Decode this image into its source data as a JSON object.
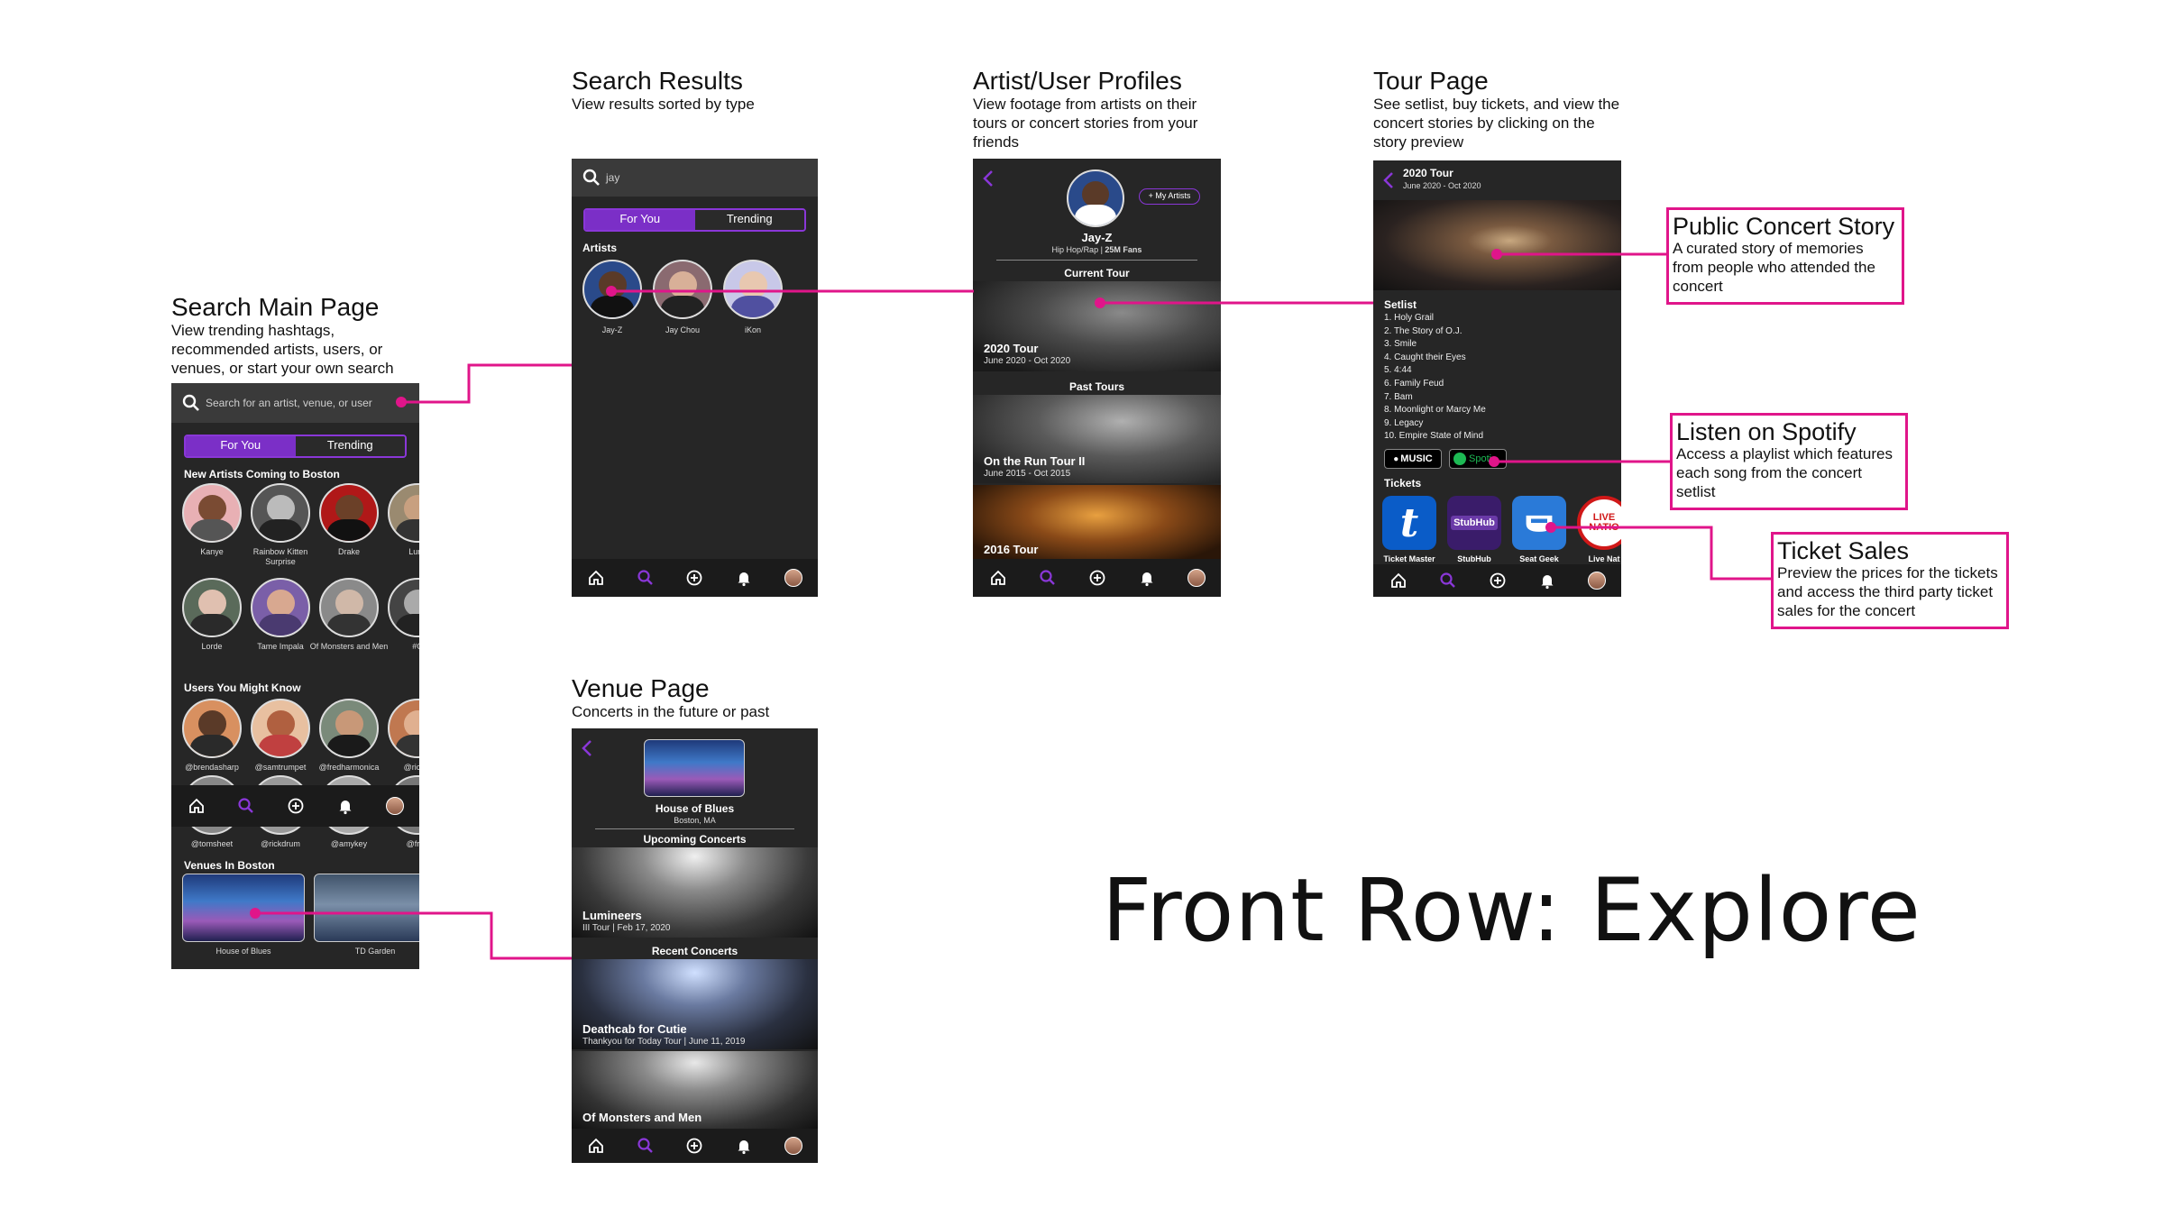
{
  "colors": {
    "accent": "#8a37d8",
    "connector": "#e0158a",
    "phone_bg": "#262626",
    "toggle_on": "#7b2fc7"
  },
  "main_title": "Front Row: Explore",
  "sections": {
    "search_main": {
      "title": "Search Main Page",
      "desc": [
        "View trending hashtags,",
        "recommended artists, users, or",
        "venues, or start your own search"
      ]
    },
    "search_results": {
      "title": "Search Results",
      "desc": [
        "View results sorted by type"
      ]
    },
    "artist_profiles": {
      "title": "Artist/User Profiles",
      "desc": [
        "View footage from artists on their",
        "tours or concert stories from your",
        "friends"
      ]
    },
    "tour_page": {
      "title": "Tour Page",
      "desc": [
        "See setlist, buy tickets, and view the",
        "concert stories by clicking on the",
        "story preview"
      ]
    },
    "venue_page": {
      "title": "Venue Page",
      "desc": [
        "Concerts in the future or past"
      ]
    }
  },
  "callouts": {
    "public_story": {
      "title": "Public Concert Story",
      "desc": [
        "A curated story of memories",
        "from people who attended the",
        "concert"
      ]
    },
    "spotify": {
      "title": "Listen on Spotify",
      "desc": [
        "Access a playlist which features",
        "each song from the concert",
        "setlist"
      ]
    },
    "tickets": {
      "title": "Ticket Sales",
      "desc": [
        "Preview the prices for the tickets",
        "and access the third party ticket",
        "sales for the concert"
      ]
    }
  },
  "search_main_phone": {
    "search_placeholder": "Search for an artist, venue, or user",
    "tabs": [
      "For You",
      "Trending"
    ],
    "new_artists_label": "New Artists Coming to Boston",
    "artists_row1": [
      "Kanye",
      "Rainbow Kitten Surprise",
      "Drake",
      "Lumi"
    ],
    "artists_row2": [
      "Lorde",
      "Tame Impala",
      "Of Monsters and Men",
      "#C"
    ],
    "users_label": "Users You Might Know",
    "users_row1": [
      "@brendasharp",
      "@samtrumpet",
      "@fredharmonica",
      "@rickm"
    ],
    "users_row2": [
      "@tomsheet",
      "@rickdrum",
      "@amykey",
      "@fred"
    ],
    "venues_label": "Venues In Boston",
    "venues": [
      "House of Blues",
      "TD Garden"
    ]
  },
  "search_results_phone": {
    "query": "jay",
    "tabs": [
      "For You",
      "Trending"
    ],
    "artists_label": "Artists",
    "artists": [
      "Jay-Z",
      "Jay Chou",
      "iKon"
    ]
  },
  "artist_phone": {
    "my_artists_btn": "+ My Artists",
    "name": "Jay-Z",
    "genre": "Hip Hop/Rap | ",
    "fans": "25M Fans",
    "current_tour_label": "Current Tour",
    "current_tour": {
      "title": "2020 Tour",
      "dates": "June 2020 - Oct 2020"
    },
    "past_tours_label": "Past Tours",
    "past_tours": [
      {
        "title": "On the Run Tour II",
        "dates": "June 2015 - Oct 2015"
      },
      {
        "title": "2016 Tour",
        "dates": ""
      }
    ]
  },
  "tour_phone": {
    "title": "2020 Tour",
    "dates": "June 2020 - Oct 2020",
    "setlist_label": "Setlist",
    "setlist": [
      "1. Holy Grail",
      "2. The Story of O.J.",
      "3. Smile",
      "4. Caught their Eyes",
      "5. 4:44",
      "6. Family Feud",
      "7. Bam",
      "8. Moonlight or Marcy Me",
      "9. Legacy",
      "10. Empire State of Mind"
    ],
    "apple_music": "MUSIC",
    "spotify": "Spoti",
    "tickets_label": "Tickets",
    "ticket_sellers": [
      "Ticket Master",
      "StubHub",
      "Seat Geek",
      "Live Nat"
    ],
    "stubhub_logo": "StubHub",
    "ticketmaster_logo": "t",
    "livenation_logo": "LIVE NATIO"
  },
  "venue_phone": {
    "venue_name": "House of Blues",
    "venue_location": "Boston, MA",
    "upcoming_label": "Upcoming Concerts",
    "upcoming": [
      {
        "title": "Lumineers",
        "sub": "III Tour | Feb 17, 2020"
      }
    ],
    "recent_label": "Recent Concerts",
    "recent": [
      {
        "title": "Deathcab for Cutie",
        "sub": "Thankyou for Today Tour | June 11, 2019"
      },
      {
        "title": "Of Monsters and Men",
        "sub": ""
      }
    ]
  }
}
